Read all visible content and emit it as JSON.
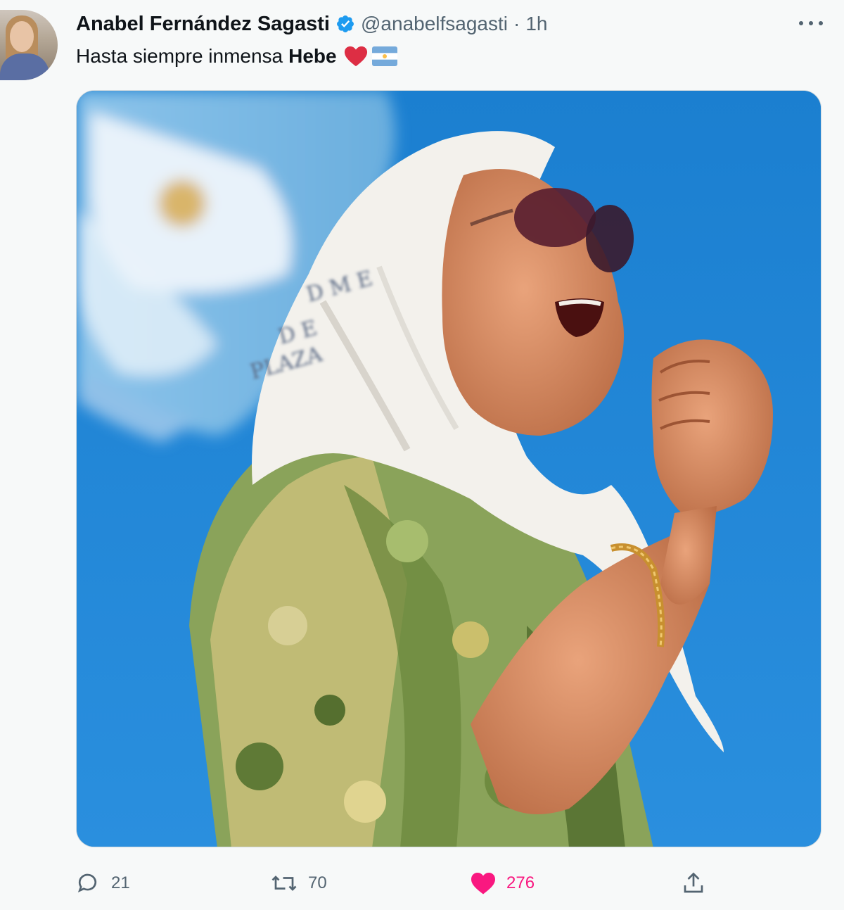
{
  "tweet": {
    "author_name": "Anabel Fernández Sagasti",
    "handle": "@anabelfsagasti",
    "separator": "·",
    "time": "1h",
    "text_plain": "Hasta siempre inmensa",
    "text_bold": "Hebe",
    "emojis": [
      "red-heart",
      "argentina-flag"
    ],
    "media": {
      "type": "photo",
      "description_icon": "photo"
    }
  },
  "actions": {
    "replies": "21",
    "retweets": "70",
    "likes": "276",
    "liked": true
  },
  "colors": {
    "background": "#f7f9f9",
    "text_primary": "#0f1419",
    "text_secondary": "#536471",
    "verified_blue": "#1d9bf0",
    "like_pink": "#f91880"
  },
  "icons": {
    "verified": "verified-badge-icon",
    "more": "more-icon",
    "reply": "reply-icon",
    "retweet": "retweet-icon",
    "like": "heart-filled-icon",
    "share": "share-icon"
  }
}
